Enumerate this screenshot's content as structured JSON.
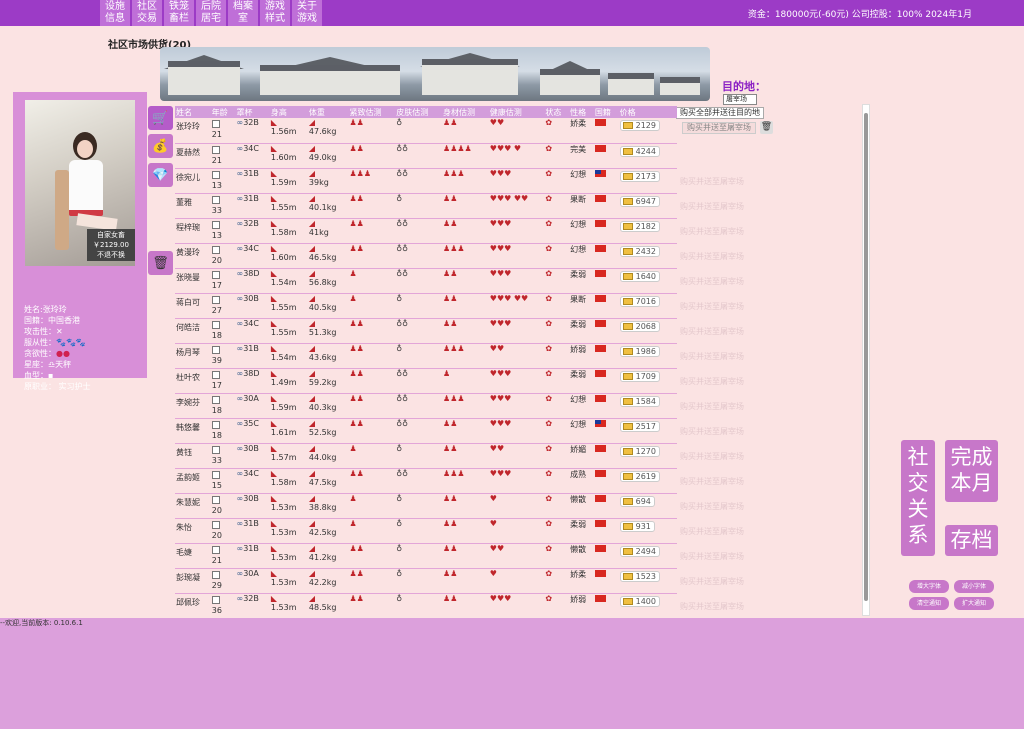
{
  "nav": [
    {
      "label": "设施\n信息"
    },
    {
      "label": "社区\n交易"
    },
    {
      "label": "铁笼\n畜栏"
    },
    {
      "label": "后院\n居宅"
    },
    {
      "label": "档案\n室"
    },
    {
      "label": "游戏\n样式"
    },
    {
      "label": "关于\n游戏"
    }
  ],
  "status": "资金：180000元(-60元) 公司控股：100% 2024年1月",
  "section_title": "社区市场供货(20)",
  "destination": {
    "label": "目的地：",
    "value": "屠宰场"
  },
  "actions": {
    "buy_all": "购买全部并送往目的地",
    "buy_send": "购买并送至屠宰场"
  },
  "profile": {
    "tag_line1": "自家女畜",
    "tag_price": "￥2129.00",
    "tag_line3": "不退不换",
    "name": "姓名:张玲玲",
    "nationality": "国籍：中国香港",
    "attack": "攻击性：",
    "obedience": "服从性：",
    "greed": "贪欲性：",
    "constellation": "星座：",
    "constellation_value": "天秤",
    "blood": "血型：",
    "job": "原职业：  实习护士"
  },
  "columns": [
    "姓名",
    "年龄",
    "罩杯",
    "身高",
    "体重",
    "紧致估测",
    "皮肤估测",
    "身材估测",
    "健康估测",
    "状态",
    "性格",
    "国籍",
    "价格"
  ],
  "rows": [
    {
      "name": "张玲玲",
      "age": "21",
      "cup": "32B",
      "height": "1.56m",
      "weight": "47.6kg",
      "tight": "♟♟",
      "skin": "♁",
      "body": "♟♟",
      "health": "♥♥",
      "state": "✿",
      "personality": "娇柔",
      "flag": "cn",
      "price": "2129"
    },
    {
      "name": "夏赫然",
      "age": "21",
      "cup": "34C",
      "height": "1.60m",
      "weight": "49.0kg",
      "tight": "♟♟",
      "skin": "♁♁",
      "body": "♟♟♟♟",
      "health": "♥♥♥ ♥",
      "state": "✿",
      "personality": "完美",
      "flag": "cn",
      "price": "4244"
    },
    {
      "name": "徐宛儿",
      "age": "13",
      "cup": "31B",
      "height": "1.59m",
      "weight": "39kg",
      "tight": "♟♟♟",
      "skin": "♁♁",
      "body": "♟♟♟",
      "health": "♥♥♥",
      "state": "✿",
      "personality": "幻想",
      "flag": "tw",
      "price": "2173"
    },
    {
      "name": "董雅",
      "age": "33",
      "cup": "31B",
      "height": "1.55m",
      "weight": "40.1kg",
      "tight": "♟♟",
      "skin": "♁",
      "body": "♟♟",
      "health": "♥♥♥ ♥♥",
      "state": "✿",
      "personality": "果断",
      "flag": "cn",
      "price": "6947"
    },
    {
      "name": "程梓琬",
      "age": "13",
      "cup": "32B",
      "height": "1.58m",
      "weight": "41kg",
      "tight": "♟♟",
      "skin": "♁♁",
      "body": "♟♟",
      "health": "♥♥♥",
      "state": "✿",
      "personality": "幻想",
      "flag": "cn",
      "price": "2182"
    },
    {
      "name": "黄漫玲",
      "age": "20",
      "cup": "34C",
      "height": "1.60m",
      "weight": "46.5kg",
      "tight": "♟♟",
      "skin": "♁♁",
      "body": "♟♟♟",
      "health": "♥♥♥",
      "state": "✿",
      "personality": "幻想",
      "flag": "cn",
      "price": "2432"
    },
    {
      "name": "张晓曼",
      "age": "17",
      "cup": "38D",
      "height": "1.54m",
      "weight": "56.8kg",
      "tight": "♟",
      "skin": "♁♁",
      "body": "♟♟",
      "health": "♥♥♥",
      "state": "✿",
      "personality": "柔弱",
      "flag": "cn",
      "price": "1640"
    },
    {
      "name": "蒋白可",
      "age": "27",
      "cup": "30B",
      "height": "1.55m",
      "weight": "40.5kg",
      "tight": "♟",
      "skin": "♁",
      "body": "♟♟",
      "health": "♥♥♥ ♥♥",
      "state": "✿",
      "personality": "果断",
      "flag": "cn",
      "price": "7016"
    },
    {
      "name": "何皓洁",
      "age": "18",
      "cup": "34C",
      "height": "1.55m",
      "weight": "51.3kg",
      "tight": "♟♟",
      "skin": "♁♁",
      "body": "♟♟",
      "health": "♥♥♥",
      "state": "✿",
      "personality": "柔弱",
      "flag": "cn",
      "price": "2068"
    },
    {
      "name": "杨月琴",
      "age": "39",
      "cup": "31B",
      "height": "1.54m",
      "weight": "43.6kg",
      "tight": "♟♟",
      "skin": "♁",
      "body": "♟♟♟",
      "health": "♥♥",
      "state": "✿",
      "personality": "娇弱",
      "flag": "cn",
      "price": "1986"
    },
    {
      "name": "杜叶农",
      "age": "17",
      "cup": "38D",
      "height": "1.49m",
      "weight": "59.2kg",
      "tight": "♟♟",
      "skin": "♁♁",
      "body": "♟",
      "health": "♥♥♥",
      "state": "✿",
      "personality": "柔弱",
      "flag": "cn",
      "price": "1709"
    },
    {
      "name": "李婉芬",
      "age": "18",
      "cup": "30A",
      "height": "1.59m",
      "weight": "40.3kg",
      "tight": "♟♟",
      "skin": "♁♁",
      "body": "♟♟♟",
      "health": "♥♥♥",
      "state": "✿",
      "personality": "幻想",
      "flag": "cn",
      "price": "1584"
    },
    {
      "name": "韩悠馨",
      "age": "18",
      "cup": "35C",
      "height": "1.61m",
      "weight": "52.5kg",
      "tight": "♟♟",
      "skin": "♁♁",
      "body": "♟♟",
      "health": "♥♥♥",
      "state": "✿",
      "personality": "幻想",
      "flag": "tw",
      "price": "2517"
    },
    {
      "name": "黄钰",
      "age": "33",
      "cup": "30B",
      "height": "1.57m",
      "weight": "44.0kg",
      "tight": "♟",
      "skin": "♁",
      "body": "♟♟",
      "health": "♥♥",
      "state": "✿",
      "personality": "娇媚",
      "flag": "cn",
      "price": "1270"
    },
    {
      "name": "孟韵姬",
      "age": "15",
      "cup": "34C",
      "height": "1.58m",
      "weight": "47.5kg",
      "tight": "♟♟",
      "skin": "♁♁",
      "body": "♟♟♟",
      "health": "♥♥♥",
      "state": "✿",
      "personality": "成熟",
      "flag": "cn",
      "price": "2619"
    },
    {
      "name": "朱慧妮",
      "age": "20",
      "cup": "30B",
      "height": "1.53m",
      "weight": "38.8kg",
      "tight": "♟",
      "skin": "♁",
      "body": "♟♟",
      "health": "♥",
      "state": "✿",
      "personality": "懒散",
      "flag": "cn",
      "price": "694"
    },
    {
      "name": "朱怡",
      "age": "20",
      "cup": "31B",
      "height": "1.53m",
      "weight": "42.5kg",
      "tight": "♟",
      "skin": "♁",
      "body": "♟♟",
      "health": "♥",
      "state": "✿",
      "personality": "柔弱",
      "flag": "cn",
      "price": "931"
    },
    {
      "name": "毛婕",
      "age": "21",
      "cup": "31B",
      "height": "1.53m",
      "weight": "41.2kg",
      "tight": "♟♟",
      "skin": "♁",
      "body": "♟♟",
      "health": "♥♥",
      "state": "✿",
      "personality": "懒散",
      "flag": "cn",
      "price": "2494"
    },
    {
      "name": "彭琬凝",
      "age": "29",
      "cup": "30A",
      "height": "1.53m",
      "weight": "42.2kg",
      "tight": "♟♟",
      "skin": "♁",
      "body": "♟♟",
      "health": "♥",
      "state": "✿",
      "personality": "娇柔",
      "flag": "cn",
      "price": "1523"
    },
    {
      "name": "邱佩珍",
      "age": "36",
      "cup": "32B",
      "height": "1.53m",
      "weight": "48.5kg",
      "tight": "♟♟",
      "skin": "♁",
      "body": "♟♟",
      "health": "♥♥♥",
      "state": "✿",
      "personality": "娇弱",
      "flag": "cn",
      "price": "1400"
    }
  ],
  "right_buttons": {
    "social": "社\n交\n关\n系",
    "finish": "完成\n本月",
    "save": "存档"
  },
  "small_buttons": {
    "font_up": "增大字体",
    "font_down": "减小字体",
    "clear": "清空通知",
    "expand": "扩大通知"
  },
  "version": "--欢迎,当前版本: 0.10.6.1"
}
